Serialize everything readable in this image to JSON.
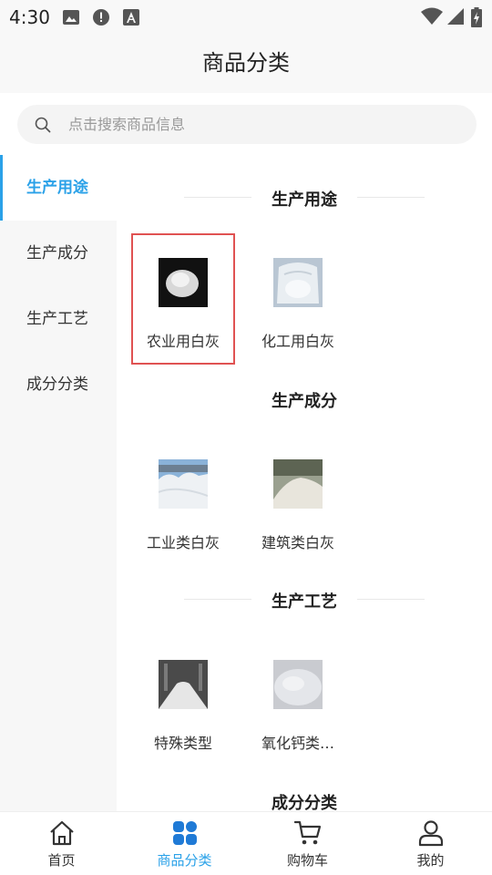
{
  "status_bar": {
    "time": "4:30",
    "icons_left": [
      "image-icon",
      "alert-icon",
      "text-a-icon"
    ],
    "icons_right": [
      "wifi-icon",
      "cellular-icon",
      "battery-charging-icon"
    ]
  },
  "header": {
    "title": "商品分类"
  },
  "search": {
    "placeholder": "点击搜索商品信息",
    "value": ""
  },
  "sidebar": {
    "active_color": "#2aa1e8",
    "items": [
      {
        "label": "生产用途",
        "active": true
      },
      {
        "label": "生产成分",
        "active": false
      },
      {
        "label": "生产工艺",
        "active": false
      },
      {
        "label": "成分分类",
        "active": false
      }
    ]
  },
  "content": {
    "sections": [
      {
        "title": "生产用途",
        "products": [
          {
            "name": "农业用白灰",
            "selected": true
          },
          {
            "name": "化工用白灰"
          }
        ]
      },
      {
        "title": "生产成分",
        "products": [
          {
            "name": "工业类白灰"
          },
          {
            "name": "建筑类白灰"
          }
        ]
      },
      {
        "title": "生产工艺",
        "products": [
          {
            "name": "特殊类型"
          },
          {
            "name": "氧化钙类…"
          }
        ]
      },
      {
        "title": "成分分类",
        "products": []
      }
    ],
    "selection_color": "#e05252"
  },
  "bottom_nav": {
    "items": [
      {
        "label": "首页",
        "icon": "home-icon",
        "active": false
      },
      {
        "label": "商品分类",
        "icon": "category-grid-icon",
        "active": true
      },
      {
        "label": "购物车",
        "icon": "cart-icon",
        "active": false
      },
      {
        "label": "我的",
        "icon": "user-icon",
        "active": false
      }
    ]
  }
}
